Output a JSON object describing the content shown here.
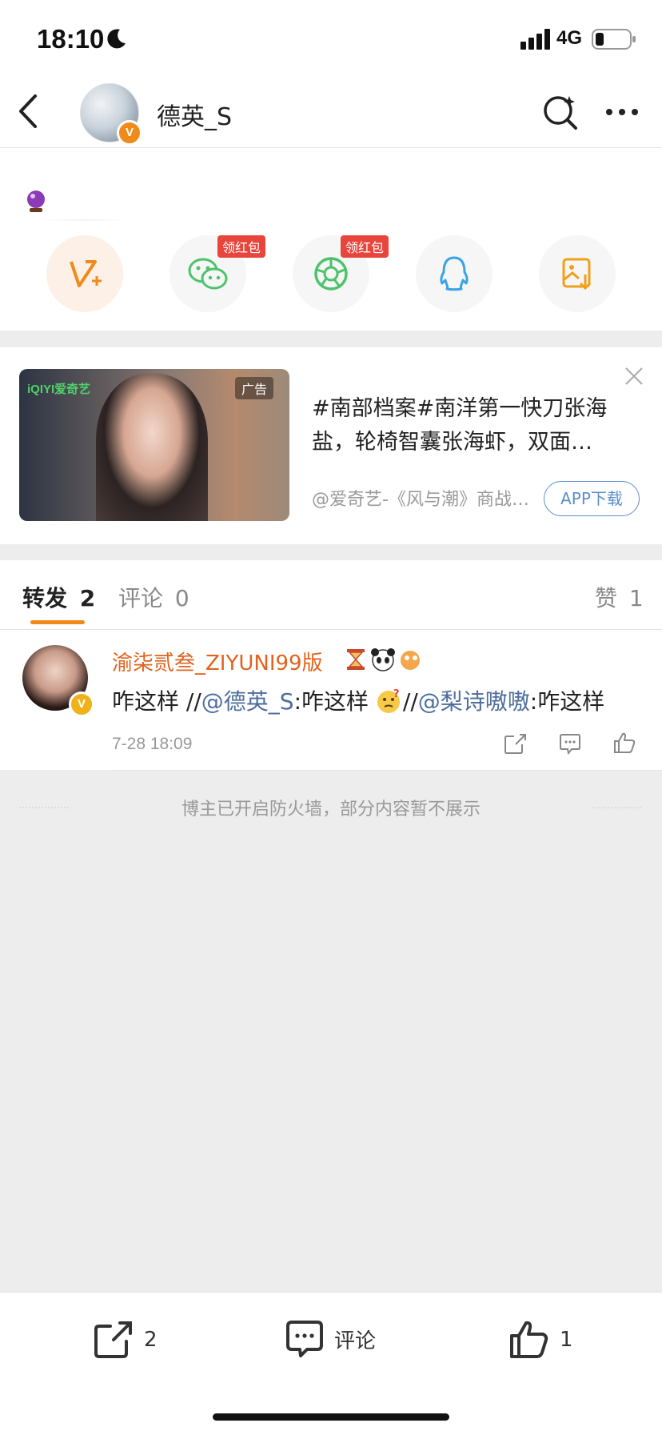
{
  "status_bar": {
    "time": "18:10",
    "network": "4G"
  },
  "nav": {
    "title": "德英_S"
  },
  "share": {
    "badge_1": "领红包",
    "badge_2": "领红包"
  },
  "ad": {
    "image_overlay": "iQIYI爱奇艺",
    "ad_tag": "广告",
    "text": "#南部档案#南洋第一快刀张海盐，轮椅智囊张海虾，双面…",
    "source": "@爱奇艺-《风与潮》商战…",
    "button": "APP下载"
  },
  "tabs": {
    "repost_label": "转发",
    "repost_count": "2",
    "comment_label": "评论",
    "comment_count": "0",
    "like_label": "赞",
    "like_count": "1"
  },
  "comment": {
    "name": "渝柒贰叁_ZIYUNI99版",
    "text_1": "咋这样 //",
    "mention_1": "@德英_S",
    "text_2": ":咋这样",
    "text_3": "//",
    "mention_2": "@梨诗嗷嗷",
    "text_4": ":咋这样",
    "time": "7-28 18:09"
  },
  "firewall_notice": "博主已开启防火墙，部分内容暂不展示",
  "bottom_bar": {
    "repost_count": "2",
    "comment_label": "评论",
    "like_count": "1"
  },
  "colors": {
    "accent": "#f08a1a",
    "mention": "#4e6e9d",
    "ad_button": "#5b8fc9"
  }
}
